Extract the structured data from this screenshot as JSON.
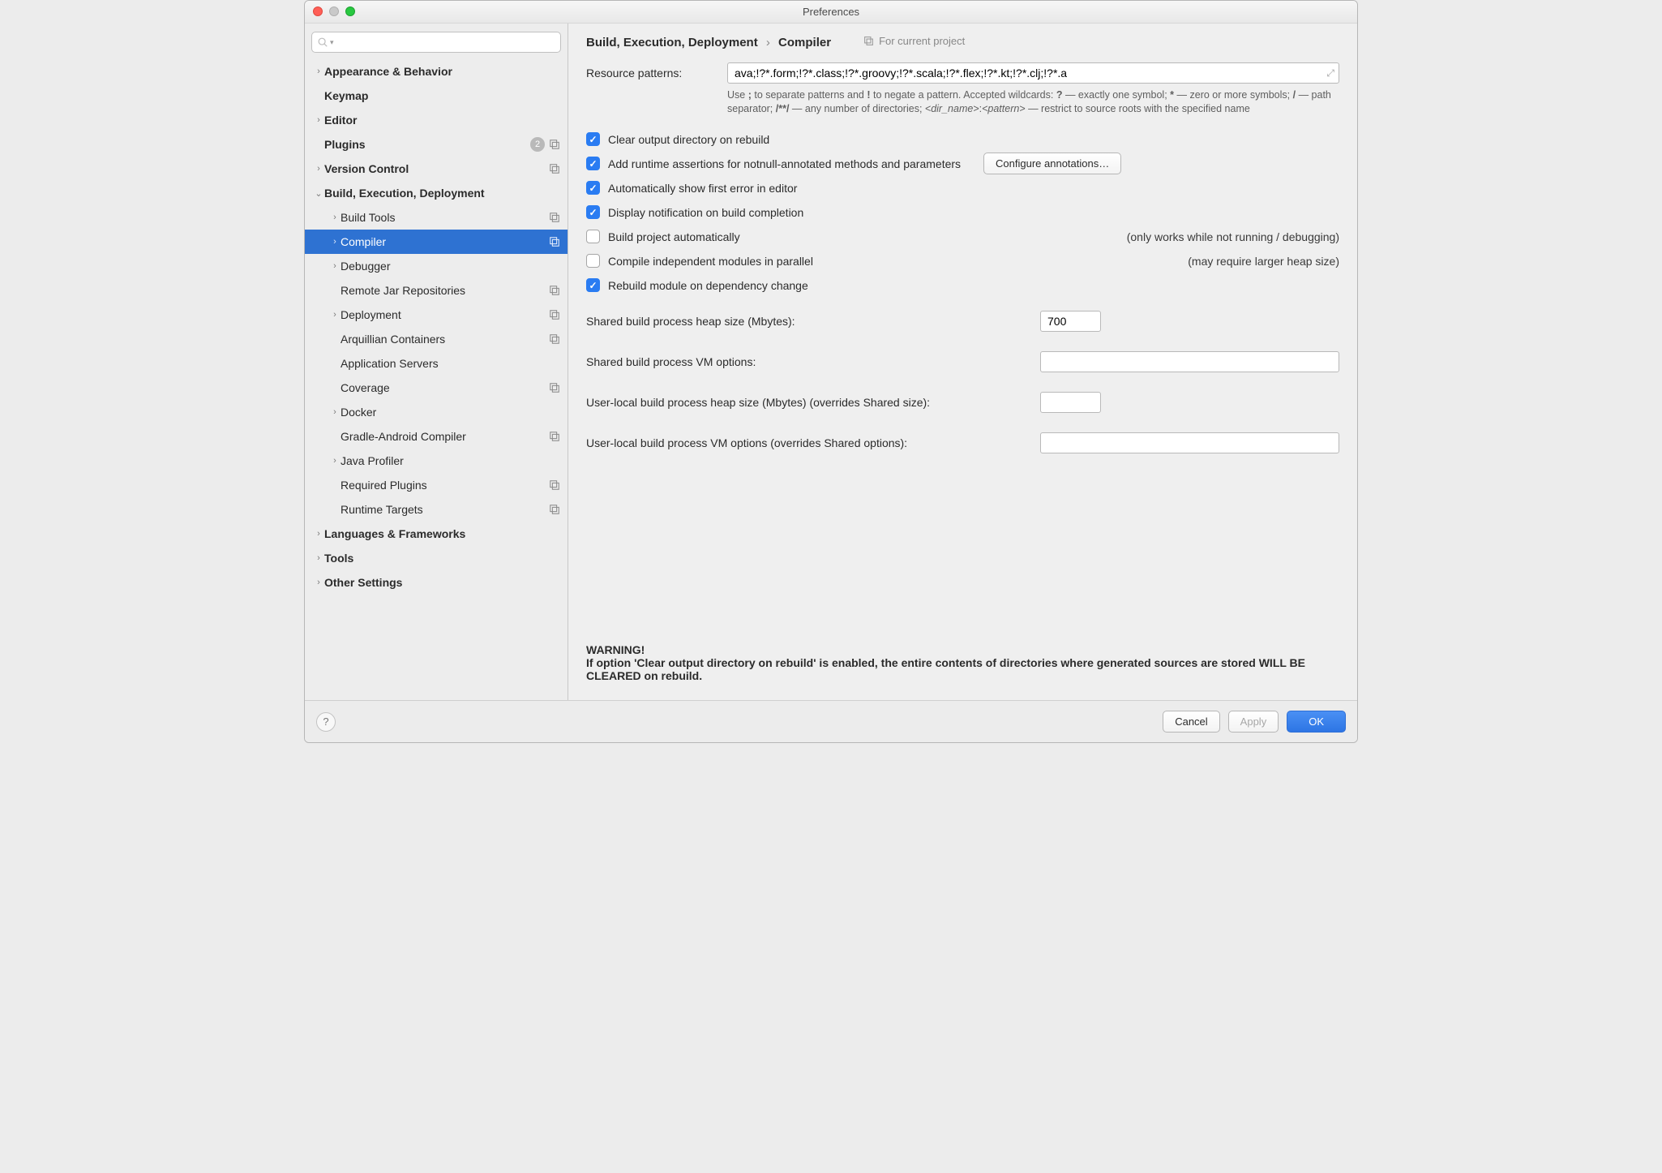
{
  "window": {
    "title": "Preferences"
  },
  "search": {
    "placeholder": ""
  },
  "sidebar": {
    "items": [
      {
        "label": "Appearance & Behavior",
        "level": 0,
        "bold": true,
        "expandable": true,
        "expanded": false
      },
      {
        "label": "Keymap",
        "level": 0,
        "bold": true,
        "expandable": false
      },
      {
        "label": "Editor",
        "level": 0,
        "bold": true,
        "expandable": true,
        "expanded": false
      },
      {
        "label": "Plugins",
        "level": 0,
        "bold": true,
        "expandable": false,
        "badge": "2",
        "projectIcon": true
      },
      {
        "label": "Version Control",
        "level": 0,
        "bold": true,
        "expandable": true,
        "expanded": false,
        "projectIcon": true
      },
      {
        "label": "Build, Execution, Deployment",
        "level": 0,
        "bold": true,
        "expandable": true,
        "expanded": true
      },
      {
        "label": "Build Tools",
        "level": 1,
        "expandable": true,
        "expanded": false,
        "projectIcon": true
      },
      {
        "label": "Compiler",
        "level": 1,
        "expandable": true,
        "expanded": false,
        "projectIcon": true,
        "selected": true
      },
      {
        "label": "Debugger",
        "level": 1,
        "expandable": true,
        "expanded": false
      },
      {
        "label": "Remote Jar Repositories",
        "level": 1,
        "expandable": false,
        "projectIcon": true
      },
      {
        "label": "Deployment",
        "level": 1,
        "expandable": true,
        "expanded": false,
        "projectIcon": true
      },
      {
        "label": "Arquillian Containers",
        "level": 1,
        "expandable": false,
        "projectIcon": true
      },
      {
        "label": "Application Servers",
        "level": 1,
        "expandable": false
      },
      {
        "label": "Coverage",
        "level": 1,
        "expandable": false,
        "projectIcon": true
      },
      {
        "label": "Docker",
        "level": 1,
        "expandable": true,
        "expanded": false
      },
      {
        "label": "Gradle-Android Compiler",
        "level": 1,
        "expandable": false,
        "projectIcon": true
      },
      {
        "label": "Java Profiler",
        "level": 1,
        "expandable": true,
        "expanded": false
      },
      {
        "label": "Required Plugins",
        "level": 1,
        "expandable": false,
        "projectIcon": true
      },
      {
        "label": "Runtime Targets",
        "level": 1,
        "expandable": false,
        "projectIcon": true
      },
      {
        "label": "Languages & Frameworks",
        "level": 0,
        "bold": true,
        "expandable": true,
        "expanded": false
      },
      {
        "label": "Tools",
        "level": 0,
        "bold": true,
        "expandable": true,
        "expanded": false
      },
      {
        "label": "Other Settings",
        "level": 0,
        "bold": true,
        "expandable": true,
        "expanded": false
      }
    ]
  },
  "header": {
    "breadcrumb": {
      "section": "Build, Execution, Deployment",
      "page": "Compiler"
    },
    "scope": "For current project"
  },
  "fields": {
    "resource_patterns_label": "Resource patterns:",
    "resource_patterns_value": "ava;!?*.form;!?*.class;!?*.groovy;!?*.scala;!?*.flex;!?*.kt;!?*.clj;!?*.a",
    "hint_line1_plain_a": "Use ",
    "hint_line1_bold_a": ";",
    "hint_line1_plain_b": " to separate patterns and ",
    "hint_line1_bold_b": "!",
    "hint_line1_plain_c": " to negate a pattern. Accepted wildcards: ",
    "hint_line1_bold_c": "?",
    "hint_line1_plain_d": " — exactly one symbol; ",
    "hint_line1_bold_d": "*",
    "hint_line1_plain_e": " — zero or more symbols; ",
    "hint_line1_bold_e": "/",
    "hint_line1_plain_f": " — path separator; ",
    "hint_line1_bold_f": "/**/",
    "hint_line1_plain_g": " — any number of directories; ",
    "hint_line1_italic_a": "<dir_name>",
    "hint_line1_plain_h": ":",
    "hint_line1_italic_b": "<pattern>",
    "hint_line1_plain_i": " — restrict to source roots with the specified name",
    "configure_btn": "Configure annotations…",
    "heap_size_label": "Shared build process heap size (Mbytes):",
    "heap_size_value": "700",
    "shared_vm_label": "Shared build process VM options:",
    "shared_vm_value": "",
    "user_heap_label": "User-local build process heap size (Mbytes) (overrides Shared size):",
    "user_heap_value": "",
    "user_vm_label": "User-local build process VM options (overrides Shared options):",
    "user_vm_value": ""
  },
  "checks": [
    {
      "label": "Clear output directory on rebuild",
      "checked": true
    },
    {
      "label": "Add runtime assertions for notnull-annotated methods and parameters",
      "checked": true,
      "button": true
    },
    {
      "label": "Automatically show first error in editor",
      "checked": true
    },
    {
      "label": "Display notification on build completion",
      "checked": true
    },
    {
      "label": "Build project automatically",
      "checked": false,
      "note": "(only works while not running / debugging)"
    },
    {
      "label": "Compile independent modules in parallel",
      "checked": false,
      "note": "(may require larger heap size)"
    },
    {
      "label": "Rebuild module on dependency change",
      "checked": true
    }
  ],
  "warning": {
    "title": "WARNING!",
    "body": "If option 'Clear output directory on rebuild' is enabled, the entire contents of directories where generated sources are stored WILL BE CLEARED on rebuild."
  },
  "footer": {
    "cancel": "Cancel",
    "apply": "Apply",
    "ok": "OK"
  }
}
